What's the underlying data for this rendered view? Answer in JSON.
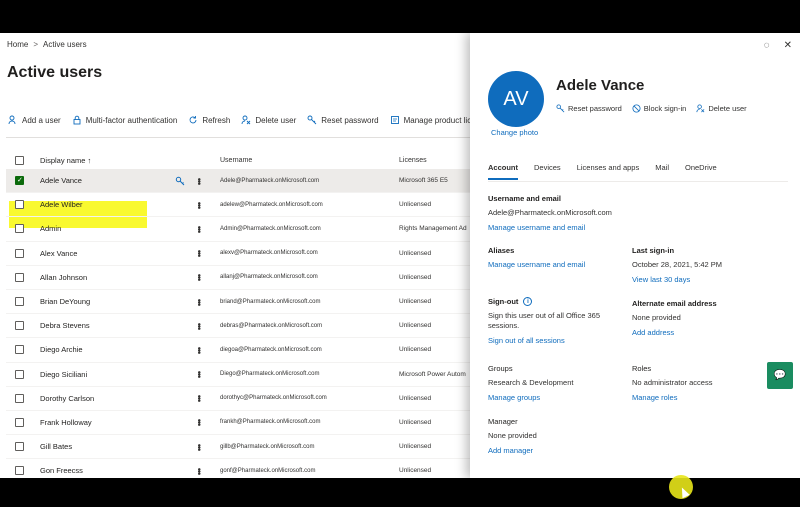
{
  "breadcrumb": {
    "home": "Home",
    "separator": ">",
    "current": "Active users"
  },
  "page_title": "Active users",
  "toolbar": {
    "add_user": "Add a user",
    "mfa": "Multi-factor authentication",
    "refresh": "Refresh",
    "delete_user": "Delete user",
    "reset_password": "Reset password",
    "manage_licenses": "Manage product licenses"
  },
  "table": {
    "headers": {
      "display_name": "Display name ↑",
      "username": "Username",
      "licenses": "Licenses"
    },
    "rows": [
      {
        "name": "Adele Vance",
        "username": "Adele@Pharmateck.onMicrosoft.com",
        "license": "Microsoft 365 E5",
        "selected": true
      },
      {
        "name": "Adele Wilber",
        "username": "adelew@Pharmateck.onMicrosoft.com",
        "license": "Unlicensed"
      },
      {
        "name": "Admin",
        "username": "Admin@Pharmateck.onMicrosoft.com",
        "license": "Rights Management Ad"
      },
      {
        "name": "Alex Vance",
        "username": "alexv@Pharmateck.onMicrosoft.com",
        "license": "Unlicensed"
      },
      {
        "name": "Allan Johnson",
        "username": "allanj@Pharmateck.onMicrosoft.com",
        "license": "Unlicensed"
      },
      {
        "name": "Brian DeYoung",
        "username": "briand@Pharmateck.onMicrosoft.com",
        "license": "Unlicensed"
      },
      {
        "name": "Debra Stevens",
        "username": "debras@Pharmateck.onMicrosoft.com",
        "license": "Unlicensed"
      },
      {
        "name": "Diego Archie",
        "username": "diegoa@Pharmateck.onMicrosoft.com",
        "license": "Unlicensed"
      },
      {
        "name": "Diego Siciliani",
        "username": "Diego@Pharmateck.onMicrosoft.com",
        "license": "Microsoft Power Autom"
      },
      {
        "name": "Dorothy Carlson",
        "username": "dorothyc@Pharmateck.onMicrosoft.com",
        "license": "Unlicensed"
      },
      {
        "name": "Frank Holloway",
        "username": "frankh@Pharmateck.onMicrosoft.com",
        "license": "Unlicensed"
      },
      {
        "name": "Gill Bates",
        "username": "gillb@Pharmateck.onMicrosoft.com",
        "license": "Unlicensed"
      },
      {
        "name": "Gon Freecss",
        "username": "gonf@Pharmateck.onMicrosoft.com",
        "license": "Unlicensed"
      }
    ]
  },
  "panel": {
    "avatar_initials": "AV",
    "change_photo": "Change photo",
    "user_name": "Adele Vance",
    "actions": {
      "reset_password": "Reset password",
      "block_signin": "Block sign-in",
      "delete_user": "Delete user"
    },
    "tabs": [
      "Account",
      "Devices",
      "Licenses and apps",
      "Mail",
      "OneDrive"
    ],
    "username_email": {
      "heading": "Username and email",
      "value": "Adele@Pharmateck.onMicrosoft.com",
      "link": "Manage username and email"
    },
    "aliases": {
      "heading": "Aliases",
      "link": "Manage username and email"
    },
    "last_signin": {
      "heading": "Last sign-in",
      "value": "October 28, 2021, 5:42 PM",
      "link": "View last 30 days"
    },
    "signout": {
      "heading": "Sign-out",
      "text": "Sign this user out of all Office 365 sessions.",
      "link": "Sign out of all sessions"
    },
    "alternate_email": {
      "heading": "Alternate email address",
      "value": "None provided",
      "link": "Add address"
    },
    "groups": {
      "heading": "Groups",
      "value": "Research & Development",
      "link": "Manage groups"
    },
    "roles": {
      "heading": "Roles",
      "value": "No administrator access",
      "link": "Manage roles"
    },
    "manager": {
      "heading": "Manager",
      "value": "None provided",
      "link": "Add manager"
    }
  },
  "colors": {
    "accent": "#0f6cbd",
    "selected_check": "#0b6a0b",
    "highlight": "#f8f81a",
    "chat": "#1a8c60"
  }
}
